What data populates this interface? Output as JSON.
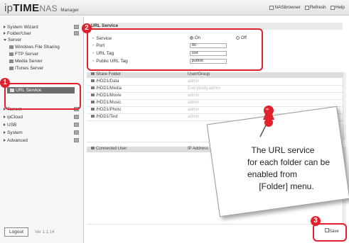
{
  "header": {
    "logo": {
      "ip": "ip",
      "time": "TIME",
      "nas": "NAS",
      "manager": "Manager"
    },
    "links": [
      "NASbrowser",
      "Refresh",
      "Help"
    ]
  },
  "sidebar": {
    "items": [
      {
        "label": "System Wizard"
      },
      {
        "label": "Folder/User"
      },
      {
        "label": "Server"
      }
    ],
    "server_sub": [
      {
        "label": "Windows File Sharing"
      },
      {
        "label": "FTP Server"
      },
      {
        "label": "Media Server"
      },
      {
        "label": "iTunes Server"
      },
      {
        "label": "URL Service"
      }
    ],
    "items_after": [
      {
        "label": "Torrent"
      },
      {
        "label": "ipCloud"
      },
      {
        "label": "USB"
      },
      {
        "label": "System"
      },
      {
        "label": "Advanced"
      }
    ],
    "logout_label": "Logout",
    "version": "Ver 1.1.14"
  },
  "main": {
    "section_title": "URL Service",
    "service_label": "Service",
    "service_on": "On",
    "service_off": "Off",
    "port_label": "Port",
    "port_value": "80",
    "url_tag_label": "URL Tag",
    "url_tag_value": "iost",
    "public_tag_label": "Public URL Tag",
    "public_tag_value": "publist",
    "share_table": {
      "col1": "Share Folder",
      "col2": "User/Group",
      "rows": [
        {
          "folder": "/HDD1/Data",
          "group": "admin"
        },
        {
          "folder": "/HDD1/Media",
          "group": "Everybody,admin"
        },
        {
          "folder": "/HDD1/Movie",
          "group": "admin"
        },
        {
          "folder": "/HDD1/Music",
          "group": "admin"
        },
        {
          "folder": "/HDD1/Photo",
          "group": "admin"
        },
        {
          "folder": "/HDD1/Test",
          "group": "admin"
        }
      ]
    },
    "conn_table": {
      "col1": "Connected User",
      "col2": "IP Address"
    },
    "save_label": "Save"
  },
  "badges": [
    "1",
    "2",
    "3"
  ],
  "note": {
    "lines": [
      "The URL service",
      "for each folder can be",
      "enabled from",
      "[Folder] menu."
    ]
  },
  "colors": {
    "highlight": "#e0202d",
    "active_menu": "#6d6d6d"
  }
}
